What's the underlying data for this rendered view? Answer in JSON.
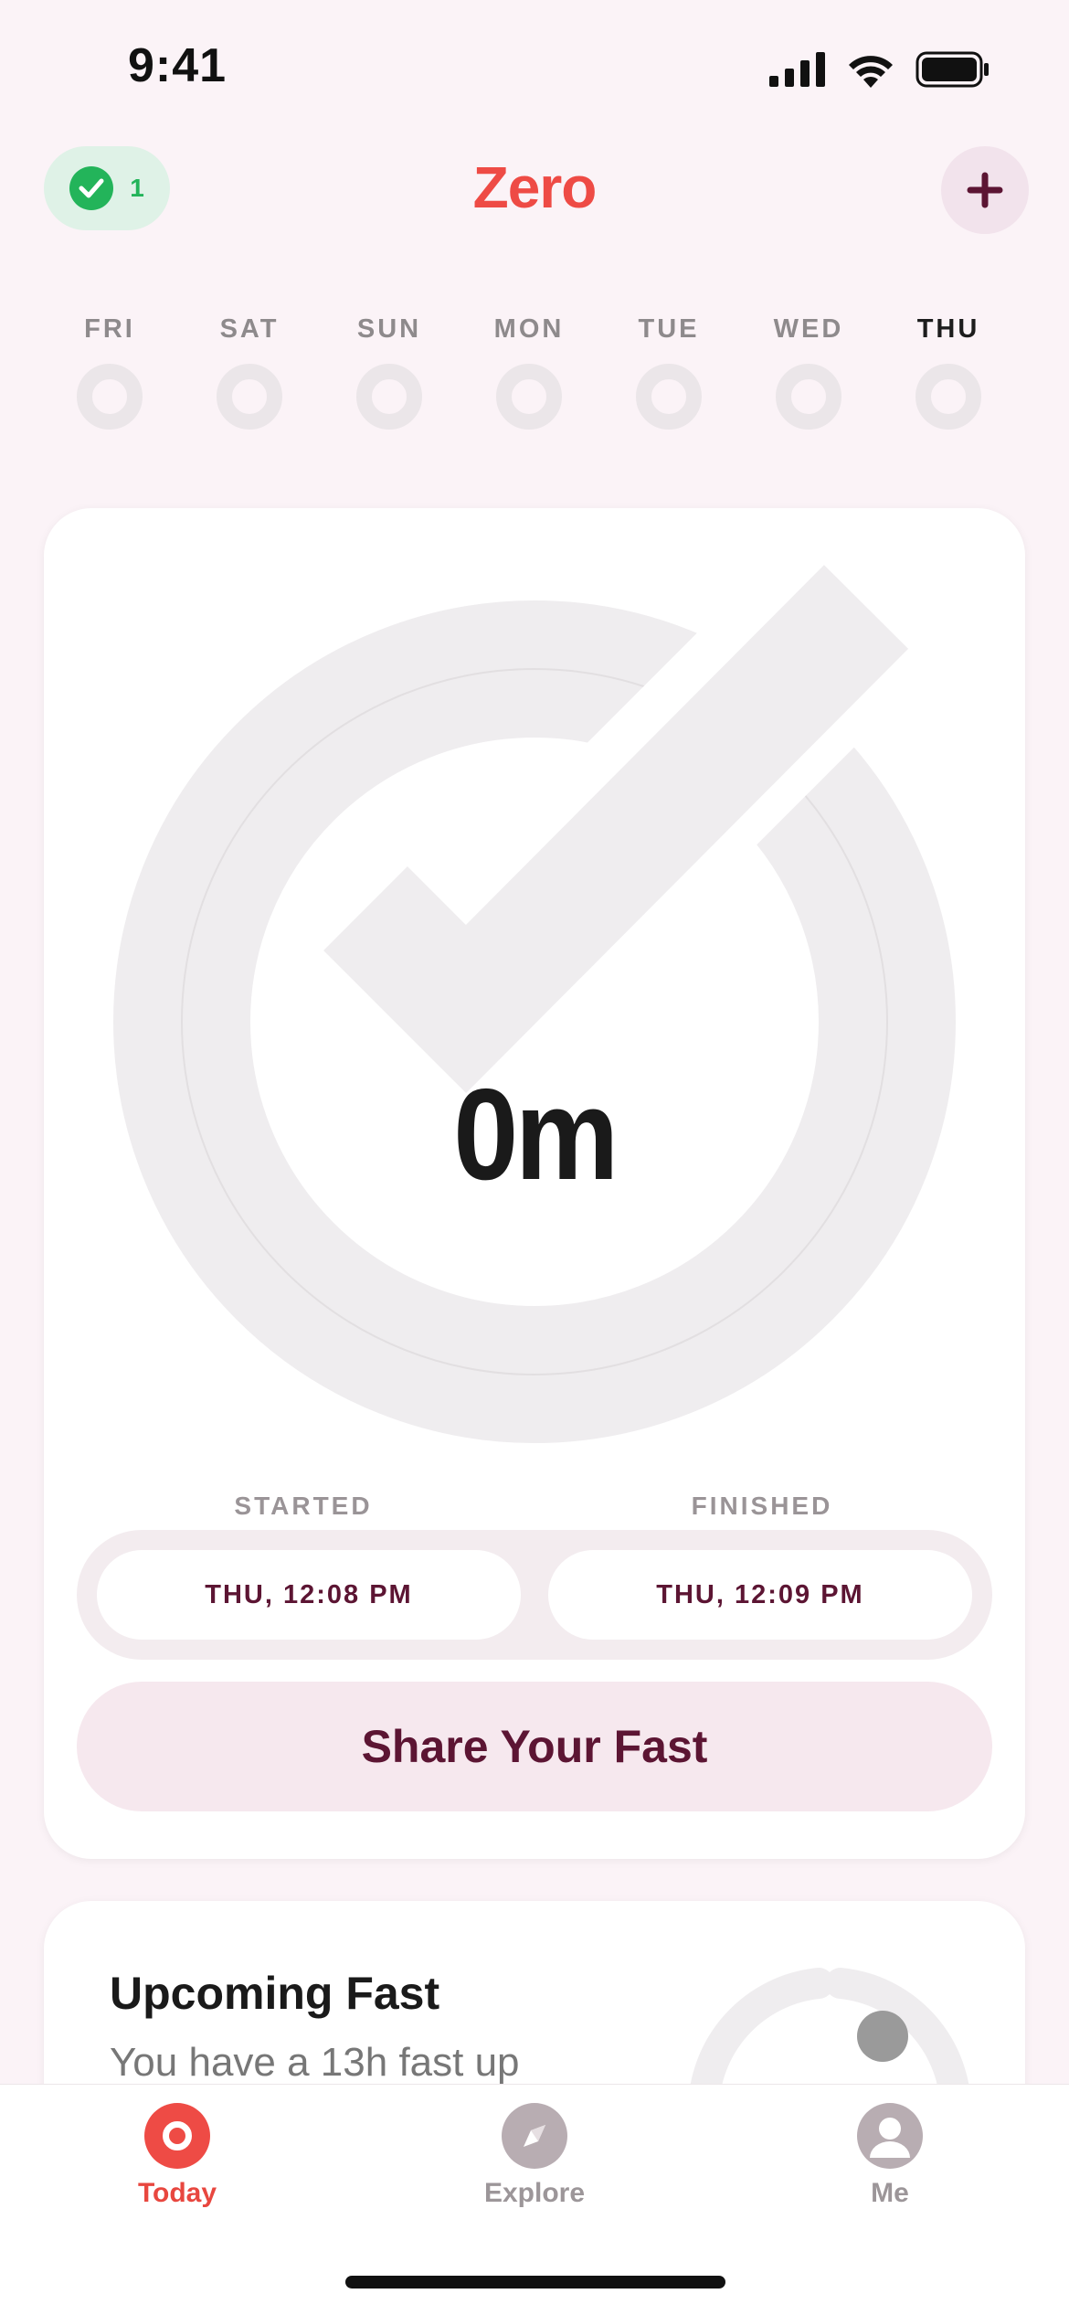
{
  "status_bar": {
    "time": "9:41"
  },
  "header": {
    "title": "Zero",
    "streak_count": "1"
  },
  "week": {
    "days": [
      "FRI",
      "SAT",
      "SUN",
      "MON",
      "TUE",
      "WED",
      "THU"
    ],
    "current_index": 6
  },
  "timer": {
    "value": "0m",
    "started_label": "STARTED",
    "finished_label": "FINISHED",
    "started_value": "THU, 12:08 PM",
    "finished_value": "THU, 12:09 PM",
    "share_label": "Share Your Fast"
  },
  "upcoming": {
    "title": "Upcoming Fast",
    "description": "You have a 13h fast up"
  },
  "tabs": [
    {
      "label": "Today",
      "icon": "today-icon",
      "active": true
    },
    {
      "label": "Explore",
      "icon": "compass-icon",
      "active": false
    },
    {
      "label": "Me",
      "icon": "profile-icon",
      "active": false
    }
  ],
  "colors": {
    "brand": "#ee4b45",
    "accent_dark": "#5c1533",
    "success": "#23b45a",
    "background": "#fbf3f7"
  }
}
